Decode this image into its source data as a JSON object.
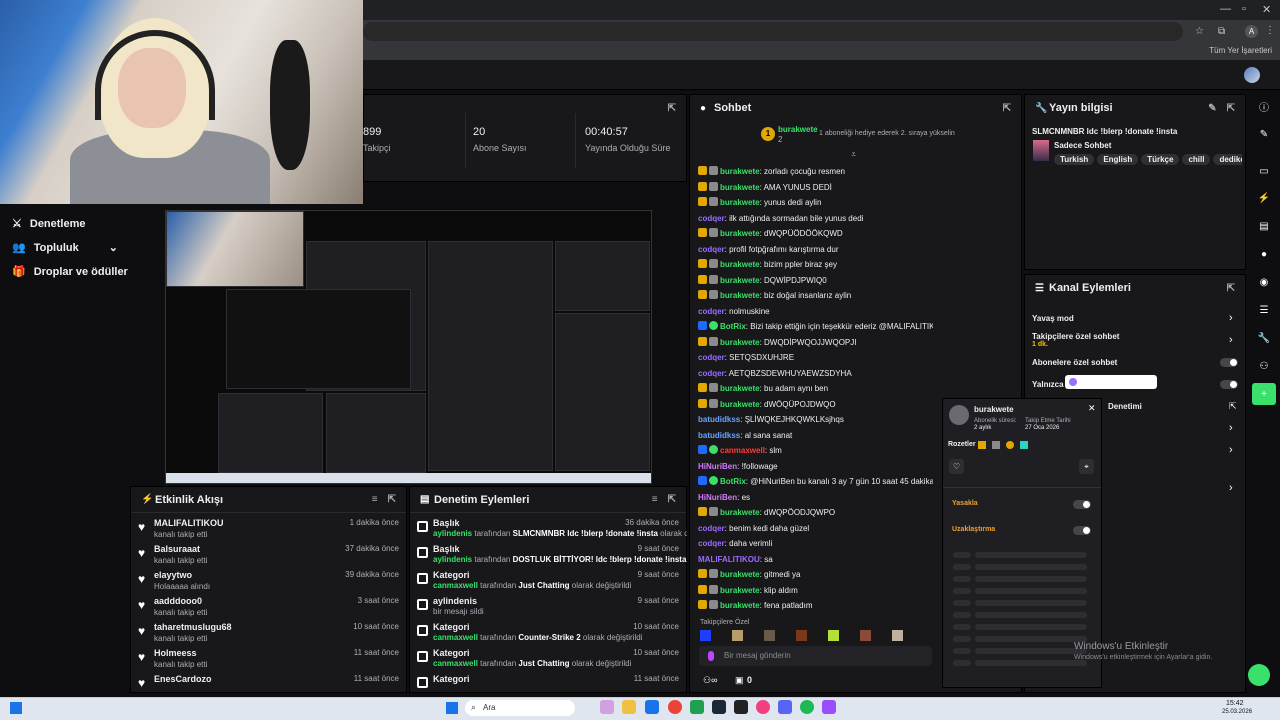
{
  "browser": {
    "bookmarks_label": "Tüm Yer İşaretleri",
    "profile_initial": "A"
  },
  "nav": [
    {
      "label": "Denetleme"
    },
    {
      "label": "Topluluk"
    },
    {
      "label": "Droplar ve ödüller"
    }
  ],
  "stats": [
    {
      "value": "899",
      "label": "Takipçi"
    },
    {
      "value": "20",
      "label": "Abone Sayısı"
    },
    {
      "value": "00:40:57",
      "label": "Yayında Olduğu Süre"
    }
  ],
  "activity": {
    "title": "Etkinlik Akışı",
    "items": [
      {
        "name": "MALIFALITIKOU",
        "sub": "kanalı takip etti",
        "time": "1 dakika önce"
      },
      {
        "name": "Balsuraaat",
        "sub": "kanalı takip etti",
        "time": "37 dakika önce"
      },
      {
        "name": "elayytwo",
        "sub": "Holaaaaa alındı",
        "time": "39 dakika önce"
      },
      {
        "name": "aadddooo0",
        "sub": "kanalı takip etti",
        "time": "3 saat önce"
      },
      {
        "name": "taharetmuslugu68",
        "sub": "kanalı takip etti",
        "time": "10 saat önce"
      },
      {
        "name": "Holmeess",
        "sub": "kanalı takip etti",
        "time": "11 saat önce"
      },
      {
        "name": "EnesCardozo",
        "sub": "",
        "time": "11 saat önce"
      }
    ]
  },
  "moderation": {
    "title": "Denetim Eylemleri",
    "items": [
      {
        "title": "Başlık",
        "user": "aylindenis",
        "mid": " tarafından ",
        "target": "SLMCNMNBR ldc !blerp !donate !insta",
        "tail": " olarak değiştirildi",
        "time": "36 dakika önce"
      },
      {
        "title": "Başlık",
        "user": "aylindenis",
        "mid": " tarafından ",
        "target": "DOSTLUK BİTTİYOR! ldc !blerp !donate !insta",
        "tail": " olarak değiştirildi",
        "time": "9 saat önce"
      },
      {
        "title": "Kategori",
        "user": "canmaxwell",
        "mid": " tarafından ",
        "target": "Just Chatting",
        "tail": " olarak değiştirildi",
        "time": "9 saat önce"
      },
      {
        "title": "aylindenis",
        "user": "",
        "mid": "bir mesajı sildi",
        "target": "",
        "tail": "",
        "time": "9 saat önce"
      },
      {
        "title": "Kategori",
        "user": "canmaxwell",
        "mid": " tarafından ",
        "target": "Counter-Strike 2",
        "tail": " olarak değiştirildi",
        "time": "10 saat önce"
      },
      {
        "title": "Kategori",
        "user": "canmaxwell",
        "mid": " tarafından ",
        "target": "Just Chatting",
        "tail": " olarak değiştirildi",
        "time": "10 saat önce"
      },
      {
        "title": "Kategori",
        "user": "",
        "mid": "",
        "target": "",
        "tail": "",
        "time": "11 saat önce"
      }
    ]
  },
  "chat": {
    "title": "Sohbet",
    "pinned_user": "burakwete",
    "pinned_count": "2",
    "pinned_msg": "1 aboneliği hediye ederek 2. sıraya yükselin",
    "messages": [
      {
        "user": "burakwete",
        "color": "g",
        "text": "zorladı çocuğu resmen",
        "badge": "sub"
      },
      {
        "user": "burakwete",
        "color": "g",
        "text": "AMA YUNUS DEDİ",
        "badge": "sub"
      },
      {
        "user": "burakwete",
        "color": "g",
        "text": "yunus dedi aylin",
        "badge": "sub"
      },
      {
        "user": "codqer",
        "color": "p",
        "text": "ilk attığında sormadan bile yunus dedi",
        "badge": "none"
      },
      {
        "user": "burakwete",
        "color": "g",
        "text": "dWQPÜÖDÖÖKQWD",
        "badge": "sub"
      },
      {
        "user": "codqer",
        "color": "p",
        "text": "profil fotpğrafımı karıştırma dur",
        "badge": "none"
      },
      {
        "user": "burakwete",
        "color": "g",
        "text": "bizim ppler biraz şey",
        "badge": "sub"
      },
      {
        "user": "burakwete",
        "color": "g",
        "text": "DQWİPDJPWIQ0",
        "badge": "sub"
      },
      {
        "user": "burakwete",
        "color": "g",
        "text": "biz doğal insanlarız aylin",
        "badge": "sub"
      },
      {
        "user": "codqer",
        "color": "p",
        "text": "nolmuskine",
        "badge": "none"
      },
      {
        "user": "BotRix",
        "color": "g",
        "text": "Bizi takip ettiğin için teşekkür ederiz @MALIFALITIKOU",
        "badge": "bot"
      },
      {
        "user": "burakwete",
        "color": "g",
        "text": "DWQDİPWQOJJWQOPJI",
        "badge": "sub"
      },
      {
        "user": "codqer",
        "color": "p",
        "text": "SETQSDXUHJRE",
        "badge": "none"
      },
      {
        "user": "codqer",
        "color": "p",
        "text": "AETQBZSDEWHUYAEWZSDYHA",
        "badge": "none"
      },
      {
        "user": "burakwete",
        "color": "g",
        "text": "bu adam aynı ben",
        "badge": "sub"
      },
      {
        "user": "burakwete",
        "color": "g",
        "text": "dWÖQÜPOJDWQO",
        "badge": "sub"
      },
      {
        "user": "batudidkss",
        "color": "bl",
        "text": "ŞLİWQKEJHKQWKLKsjhqs",
        "badge": "none"
      },
      {
        "user": "batudidkss",
        "color": "bl",
        "text": "al sana sanat",
        "badge": "none"
      },
      {
        "user": "canmaxwell",
        "color": "r",
        "text": "slm",
        "badge": "bot"
      },
      {
        "user": "HiNuriBen",
        "color": "pk",
        "text": "!followage",
        "badge": "none"
      },
      {
        "user": "BotRix",
        "color": "g",
        "text": "@HiNuriBen bu kanalı 3 ay 7 gün 10 saat 45 dakika süredir ta",
        "badge": "bot"
      },
      {
        "user": "HiNuriBen",
        "color": "pk",
        "text": "es",
        "badge": "none"
      },
      {
        "user": "burakwete",
        "color": "g",
        "text": "dWQPÖODJQWPO",
        "badge": "sub"
      },
      {
        "user": "codqer",
        "color": "p",
        "text": "benim kedi daha güzel",
        "badge": "none"
      },
      {
        "user": "codqer",
        "color": "p",
        "text": "daha verimli",
        "badge": "none"
      },
      {
        "user": "MALIFALITIKOU",
        "color": "p",
        "text": "sa",
        "badge": "none"
      },
      {
        "user": "burakwete",
        "color": "g",
        "text": "gitmedi ya",
        "badge": "sub"
      },
      {
        "user": "burakwete",
        "color": "g",
        "text": "klip aldım",
        "badge": "sub"
      },
      {
        "user": "burakwete",
        "color": "g",
        "text": "fena patladım",
        "badge": "sub"
      }
    ],
    "followers_only": "Takipçilere Özel",
    "input_placeholder": "Bir mesaj gönderin",
    "bottom_count": "0"
  },
  "stream_info": {
    "title": "Yayın bilgisi",
    "stream_title": "SLMCNMNBR ldc !blerp !donate !insta",
    "category": "Sadece Sohbet",
    "tags": [
      "Turkish",
      "English",
      "Türkçe",
      "chill",
      "dedikodu",
      "fu"
    ]
  },
  "channel_actions": {
    "title": "Kanal Eylemleri",
    "slow_mode": "Yavaş mod",
    "followers_chat": "Takipçilere özel sohbet",
    "followers_chat_sub": "1 dk.",
    "subs_chat": "Abonelere özel sohbet",
    "only_prefix": "Yalnızca İfa",
    "moderation_suffix": "Denetimi"
  },
  "user_card": {
    "name": "burakwete",
    "sub_label": "Abonelik süresi:",
    "sub_value": "2 aylık",
    "follow_label": "Takip Etme Tarihi",
    "follow_value": "27 Oca 2026",
    "badges_label": "Rozetler",
    "ban_label": "Yasakla",
    "timeout_label": "Uzaklaştırma"
  },
  "watermark": {
    "line1": "Windows'u Etkinleştir",
    "line2": "Windows'u etkinleştirmek için Ayarlar'a gidin."
  },
  "taskbar": {
    "search": "Ara",
    "time": "15:42",
    "date": "25.03.2026"
  }
}
